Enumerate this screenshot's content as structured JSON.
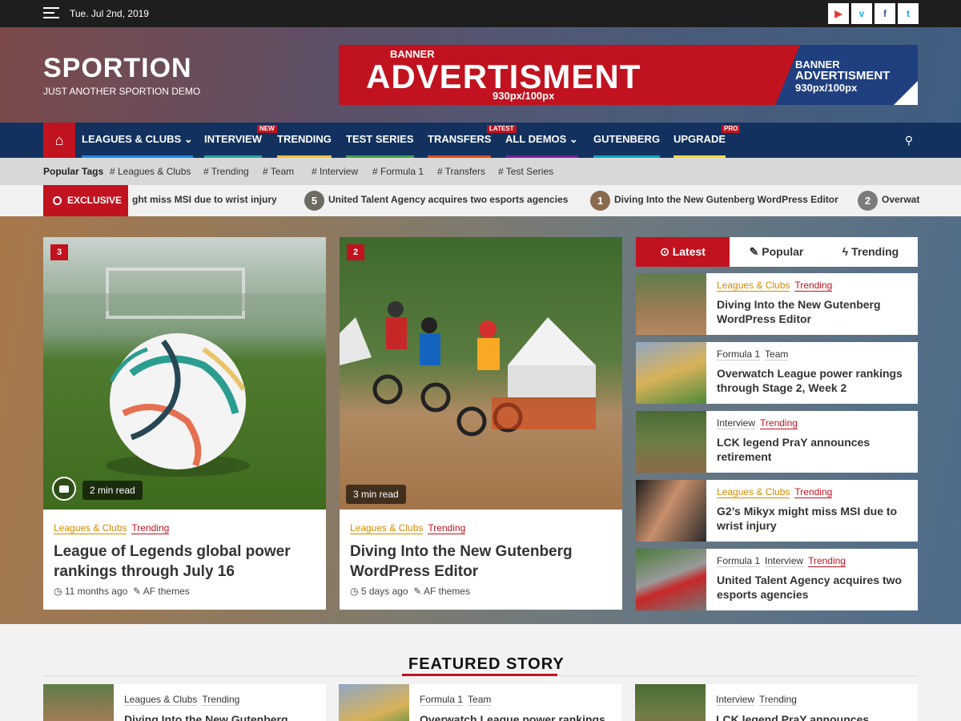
{
  "topbar": {
    "date": "Tue. Jul 2nd, 2019",
    "social_icons": [
      "youtube-icon",
      "vimeo-icon",
      "facebook-icon",
      "twitter-icon"
    ],
    "social_glyphs": [
      "▶",
      "v",
      "f",
      "t"
    ]
  },
  "site": {
    "name": "SPORTION",
    "tagline": "JUST ANOTHER SPORTION DEMO"
  },
  "banner": {
    "small_label": "BANNER",
    "big_label": "ADVERTISMENT",
    "size": "930px/100px",
    "right_small": "BANNER",
    "right_big": "ADVERTISMENT",
    "right_size": "930px/100px"
  },
  "nav": {
    "items": [
      {
        "label": "LEAGUES & CLUBS ⌄",
        "color": "#1e88e5"
      },
      {
        "label": "INTERVIEW",
        "color": "#26a69a",
        "badge": "NEW"
      },
      {
        "label": "TRENDING",
        "color": "#fbc02d"
      },
      {
        "label": "TEST SERIES",
        "color": "#43a047"
      },
      {
        "label": "TRANSFERS",
        "color": "#e64a19"
      },
      {
        "label": "ALL DEMOS ⌄",
        "color": "#7b1fa2",
        "badge": "LATEST"
      },
      {
        "label": "GUTENBERG",
        "color": "#00acc1"
      },
      {
        "label": "UPGRADE",
        "color": "#fdd835",
        "badge": "PRO"
      }
    ]
  },
  "tags": {
    "label": "Popular Tags",
    "items": [
      "# Leagues & Clubs",
      "# Trending",
      "# Team",
      "# Interview",
      "# Formula 1",
      "# Transfers",
      "# Test Series"
    ]
  },
  "ticker": {
    "label": "EXCLUSIVE",
    "items": [
      {
        "num": "",
        "text": "ght miss MSI due to wrist injury"
      },
      {
        "num": "5",
        "text": "United Talent Agency acquires two esports agencies"
      },
      {
        "num": "1",
        "text": "Diving Into the New Gutenberg WordPress Editor"
      },
      {
        "num": "2",
        "text": "Overwat"
      }
    ]
  },
  "cards": [
    {
      "count": "3",
      "read_time": "2 min read",
      "categories": [
        "Leagues & Clubs",
        "Trending"
      ],
      "title": "League of Legends global power rankings through July 16",
      "time": "11 months ago",
      "author": "AF themes"
    },
    {
      "count": "2",
      "read_time": "3 min read",
      "categories": [
        "Leagues & Clubs",
        "Trending"
      ],
      "title": "Diving Into the New Gutenberg WordPress Editor",
      "time": "5 days ago",
      "author": "AF themes"
    }
  ],
  "sidebar": {
    "tabs": [
      {
        "icon": "⊙",
        "label": "Latest"
      },
      {
        "icon": "✎",
        "label": "Popular"
      },
      {
        "icon": "ϟ",
        "label": "Trending"
      }
    ],
    "items": [
      {
        "categories": [
          "Leagues & Clubs",
          "Trending"
        ],
        "title": "Diving Into the New Gutenberg WordPress Editor"
      },
      {
        "categories": [
          "Formula 1",
          "Team"
        ],
        "title": "Overwatch League power rankings through Stage 2, Week 2"
      },
      {
        "categories": [
          "Interview",
          "Trending"
        ],
        "title": "LCK legend PraY announces retirement"
      },
      {
        "categories": [
          "Leagues & Clubs",
          "Trending"
        ],
        "title": "G2’s Mikyx might miss MSI due to wrist injury"
      },
      {
        "categories": [
          "Formula 1",
          "Interview",
          "Trending"
        ],
        "title": "United Talent Agency acquires two esports agencies"
      }
    ]
  },
  "featured": {
    "heading": "FEATURED STORY",
    "items": [
      {
        "categories": [
          "Leagues & Clubs",
          "Trending"
        ],
        "title": "Diving Into the New Gutenberg"
      },
      {
        "categories": [
          "Formula 1",
          "Team"
        ],
        "title": "Overwatch League power rankings"
      },
      {
        "categories": [
          "Interview",
          "Trending"
        ],
        "title": "LCK legend PraY announces"
      }
    ]
  }
}
